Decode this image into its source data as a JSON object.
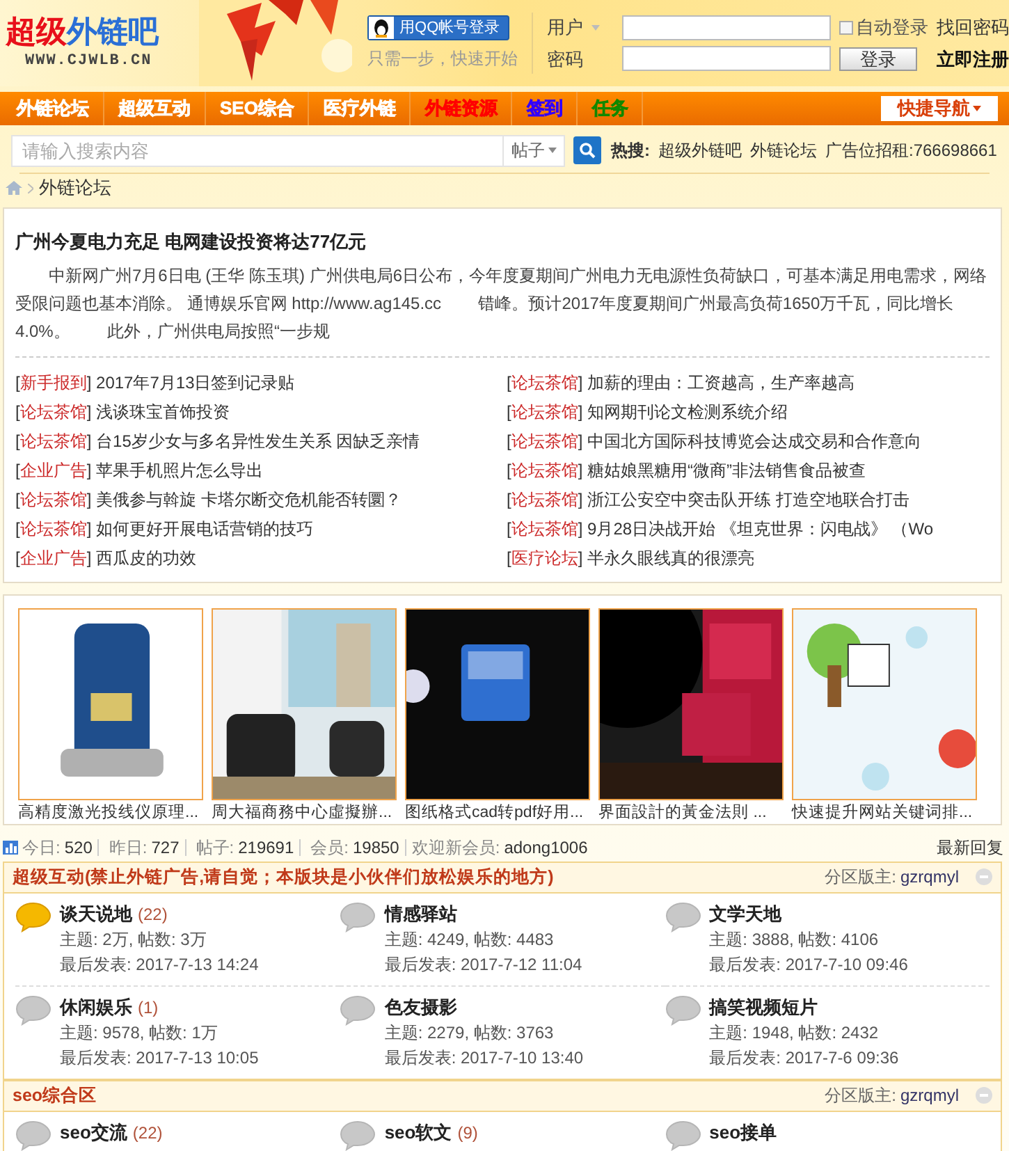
{
  "logo": {
    "title_a": "超级",
    "title_b": "外链吧",
    "url": "WWW.CJWLB.CN"
  },
  "qq_login": {
    "label": "用QQ帐号登录",
    "hint": "只需一步，快速开始"
  },
  "login": {
    "user_label": "用户",
    "password_label": "密码",
    "auto_login": {
      "label": "自动登录",
      "checked": false
    },
    "forgot": "找回密码",
    "submit": "登录",
    "register": "立即注册"
  },
  "nav": {
    "items": [
      {
        "label": "外链论坛",
        "color": "#ffffff"
      },
      {
        "label": "超级互动",
        "color": "#ffffff"
      },
      {
        "label": "SEO综合",
        "color": "#ffffff"
      },
      {
        "label": "医疗外链",
        "color": "#ffffff"
      },
      {
        "label": "外链资源",
        "color": "#ff0000"
      },
      {
        "label": "签到",
        "color": "#3300ff"
      },
      {
        "label": "任务",
        "color": "#118800"
      }
    ],
    "quick_nav": "快捷导航"
  },
  "search": {
    "placeholder": "请输入搜索内容",
    "scope": "帖子",
    "hot_label": "热搜:",
    "hot": [
      "超级外链吧",
      "外链论坛",
      "广告位招租:766698661"
    ]
  },
  "breadcrumb": [
    "外链论坛"
  ],
  "article": {
    "title": "广州今夏电力充足 电网建设投资将达77亿元",
    "body": "中新网广州7月6日电 (王华 陈玉琪) 广州供电局6日公布，今年度夏期间广州电力无电源性负荷缺口，可基本满足用电需求，网络受限问题也基本消除。 通博娱乐官网 http://www.ag145.cc        错峰。预计2017年度夏期间广州最高负荷1650万千瓦，同比增长4.0%。        此外，广州供电局按照“一步规"
  },
  "tag_brackets": [
    "[",
    "]"
  ],
  "threads": [
    {
      "tag": "新手报到",
      "title": "2017年7月13日签到记录贴"
    },
    {
      "tag": "论坛茶馆",
      "title": "加薪的理由：工资越高，生产率越高"
    },
    {
      "tag": "论坛茶馆",
      "title": "浅谈珠宝首饰投资"
    },
    {
      "tag": "论坛茶馆",
      "title": "知网期刊论文检测系统介绍"
    },
    {
      "tag": "论坛茶馆",
      "title": "台15岁少女与多名异性发生关系 因缺乏亲情"
    },
    {
      "tag": "论坛茶馆",
      "title": "中国北方国际科技博览会达成交易和合作意向"
    },
    {
      "tag": "企业广告",
      "title": "苹果手机照片怎么导出"
    },
    {
      "tag": "论坛茶馆",
      "title": "糖姑娘黑糖用“微商”非法销售食品被查"
    },
    {
      "tag": "论坛茶馆",
      "title": "美俄参与斡旋 卡塔尔断交危机能否转圜？"
    },
    {
      "tag": "论坛茶馆",
      "title": "浙江公安空中突击队开练 打造空地联合打击"
    },
    {
      "tag": "论坛茶馆",
      "title": "如何更好开展电话营销的技巧"
    },
    {
      "tag": "论坛茶馆",
      "title": "9月28日决战开始 《坦克世界：闪电战》 （Wo"
    },
    {
      "tag": "企业广告",
      "title": "西瓜皮的功效"
    },
    {
      "tag": "医疗论坛",
      "title": "半永久眼线真的很漂亮"
    }
  ],
  "gallery": [
    {
      "caption": "高精度激光投线仪原理..."
    },
    {
      "caption": "周大福商務中心虛擬辦..."
    },
    {
      "caption": "图纸格式cad转pdf好用..."
    },
    {
      "caption": "界面設計的黃金法則 ..."
    },
    {
      "caption": "快速提升网站关键词排..."
    }
  ],
  "stats": {
    "items": [
      {
        "label": "今日:",
        "value": "520"
      },
      {
        "label": "昨日:",
        "value": "727"
      },
      {
        "label": "帖子:",
        "value": "219691"
      },
      {
        "label": "会员:",
        "value": "19850"
      }
    ],
    "welcome_label": "欢迎新会员:",
    "member": "adong1006",
    "latest": "最新回复"
  },
  "sections": [
    {
      "title": "超级互动(禁止外链广告,请自觉；本版块是小伙伴们放松娱乐的地方)",
      "moderator_label": "分区版主:",
      "moderator": "gzrqmyl",
      "forums": [
        {
          "name": "谈天说地",
          "count": "(22)",
          "new": true,
          "topics": "主题: 2万, 帖数: 3万",
          "last": "最后发表: 2017-7-13 14:24"
        },
        {
          "name": "情感驿站",
          "new": false,
          "topics": "主题: 4249, 帖数: 4483",
          "last": "最后发表: 2017-7-12 11:04"
        },
        {
          "name": "文学天地",
          "new": false,
          "topics": "主题: 3888, 帖数: 4106",
          "last": "最后发表: 2017-7-10 09:46"
        },
        {
          "name": "休闲娱乐",
          "count": "(1)",
          "new": false,
          "topics": "主题: 9578, 帖数: 1万",
          "last": "最后发表: 2017-7-13 10:05"
        },
        {
          "name": "色友摄影",
          "new": false,
          "topics": "主题: 2279, 帖数: 3763",
          "last": "最后发表: 2017-7-10 13:40"
        },
        {
          "name": "搞笑视频短片",
          "new": false,
          "topics": "主题: 1948, 帖数: 2432",
          "last": "最后发表: 2017-7-6 09:36"
        }
      ]
    },
    {
      "title": "seo综合区",
      "moderator_label": "分区版主:",
      "moderator": "gzrqmyl",
      "forums": [
        {
          "name": "seo交流",
          "count": "(22)",
          "new": false
        },
        {
          "name": "seo软文",
          "count": "(9)",
          "new": false
        },
        {
          "name": "seo接单",
          "new": false
        }
      ]
    }
  ]
}
